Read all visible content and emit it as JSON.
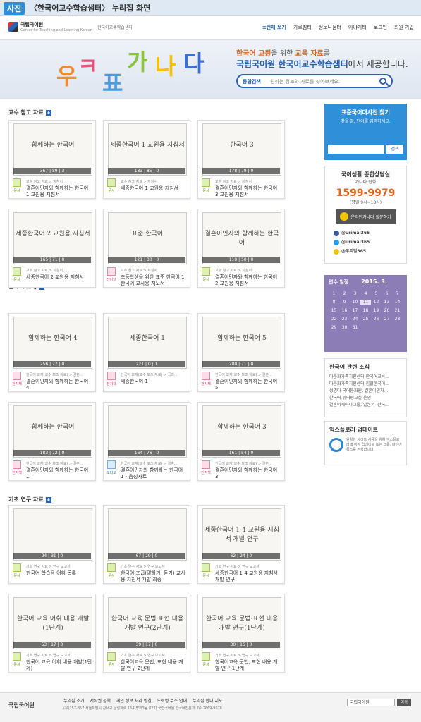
{
  "topbar": {
    "tag": "사진",
    "title": "〈한국어교수학습샘터〉 누리집 화면"
  },
  "header": {
    "org": "국립국어원",
    "org_en": "Center for Teaching and Learning Korean",
    "site": "한국어교수학습샘터",
    "nav": [
      "≡전체 보기",
      "가르침터",
      "정보나눔터",
      "이야기터",
      "로그인",
      "회원 가입"
    ]
  },
  "banner": {
    "line1_pre": "한국어 교원",
    "line1_mid": "을 위한 ",
    "line1_hl": "교육 자료",
    "line1_post": "를",
    "line2_hl": "국립국어원 한국어교수학습샘터",
    "line2_post": "에서 제공합니다.",
    "search_label": "통합검색",
    "search_placeholder": "원하는 정보와 자료를 찾아보세요."
  },
  "sections": [
    {
      "title": "교수 참고 자료",
      "items": [
        {
          "thumb": "함께하는 한국어",
          "stats": "367 | 89 | 3",
          "type": "문서",
          "meta": "교수 참고 자료 > 지침서",
          "name": "결혼이민자와 함께하는 한국어 1 교원용 지침서"
        },
        {
          "thumb": "세종한국어 1 교원용 지침서",
          "stats": "183 | 85 | 0",
          "type": "문서",
          "meta": "교수 참고 자료 > 지침서",
          "name": "세종한국어 1 교원용 지침서"
        },
        {
          "thumb": "한국어 3",
          "stats": "178 | 79 | 0",
          "type": "문서",
          "meta": "교수 참고 자료 > 지침서",
          "name": "결혼이민자와 함께하는 한국어 3 교원용 지침서"
        },
        {
          "thumb": "세종한국어 2 교원용 지침서",
          "stats": "165 | 71 | 0",
          "type": "문서",
          "meta": "교수 참고 자료 > 지침서",
          "name": "세종한국어 2 교원용 지침서"
        },
        {
          "thumb": "표준 한국어",
          "stats": "121 | 30 | 0",
          "type": "전자책",
          "meta": "교수 참고 자료 > 지침서",
          "name": "초등학생을 위한 표준 한국어 1 한국어 교사용 지도서"
        },
        {
          "thumb": "결혼이민자와 함께하는 한국어",
          "stats": "110 | 50 | 0",
          "type": "문서",
          "meta": "교수 참고 자료 > 지침서",
          "name": "결혼이민자와 함께하는 한국어 2 교원용 지침서"
        }
      ]
    },
    {
      "title": "한국어 교재",
      "items": [
        {
          "thumb": "함께하는 한국어 4",
          "stats": "256 | 77 | 0",
          "type": "전자책",
          "meta": "한국어 교재(교수 보조 자료) > 결혼...",
          "name": "결혼이민자와 함께하는 한국어 4"
        },
        {
          "thumb": "세종한국어 1",
          "stats": "221 | 0 | 1",
          "type": "전자책",
          "meta": "한국어 교재(교수 보조 자료) > 국외...",
          "name": "세종한국어 1"
        },
        {
          "thumb": "함께하는 한국어 5",
          "stats": "200 | 71 | 0",
          "type": "전자책",
          "meta": "한국어 교재(교수 보조 자료) > 결혼...",
          "name": "결혼이민자와 함께하는 한국어 5"
        },
        {
          "thumb": "함께하는 한국어",
          "stats": "183 | 72 | 0",
          "type": "전자책",
          "meta": "한국어 교재(교수 보조 자료) > 결혼...",
          "name": "결혼이민자와 함께하는 한국어 1"
        },
        {
          "thumb": "",
          "stats": "164 | 76 | 0",
          "type": "오디오",
          "meta": "한국어 교재(교수 보조 자료) > 결혼...",
          "name": "결혼이민자와 함께하는 한국어 1 - 음성자료"
        },
        {
          "thumb": "함께하는 한국어 3",
          "stats": "161 | 54 | 0",
          "type": "전자책",
          "meta": "한국어 교재(교수 보조 자료) > 결혼...",
          "name": "결혼이민자와 함께하는 한국어 3"
        }
      ]
    },
    {
      "title": "기초 연구 자료",
      "items": [
        {
          "thumb": "",
          "stats": "94 | 31 | 0",
          "type": "문서",
          "meta": "기초 연구 자료 > 연구 보고서",
          "name": "한국어 학습용 어휘 목록"
        },
        {
          "thumb": "",
          "stats": "67 | 29 | 0",
          "type": "문서",
          "meta": "기초 연구 자료 > 연구 보고서",
          "name": "한국어 초급(말하기, 듣기) 교사용 지침서 개발 최종"
        },
        {
          "thumb": "세종한국어 1-4 교원용 지침서 개발 연구",
          "stats": "62 | 24 | 0",
          "type": "문서",
          "meta": "기초 연구 자료 > 연구 보고서",
          "name": "세종한국어 1-4 교원용 지침서 개발 연구"
        },
        {
          "thumb": "한국어 교육 어휘 내용 개발(1단계)",
          "stats": "53 | 17 | 0",
          "type": "문서",
          "meta": "기초 연구 자료 > 연구 보고서",
          "name": "한국어 교육 어휘 내용 개발(1단계)"
        },
        {
          "thumb": "한국어 교육 문법·표현 내용 개발 연구(2단계)",
          "stats": "39 | 17 | 0",
          "type": "문서",
          "meta": "기초 연구 자료 > 연구 보고서",
          "name": "한국어교육 문법, 표현 내용 개발 연구 2단계"
        },
        {
          "thumb": "한국어 교육 문법·표현 내용 개발 연구(1단계)",
          "stats": "30 | 16 | 0",
          "type": "문서",
          "meta": "기초 연구 자료 > 연구 보고서",
          "name": "한국어교육 문법, 표현 내용 개발 연구 1단계"
        }
      ]
    }
  ],
  "side": {
    "quick_title": "표준국어대사전 찾기",
    "quick_sub": "찾을 말, 단어를 입력하세요.",
    "quick_btn": "검색",
    "call_title": "국어생활 종합상담실",
    "call_sub": "가나다 전화",
    "call_num": "1599-9979",
    "call_time": "(평일 9시~18시)",
    "call_ask": "온라인가나다 질문하기",
    "sns": [
      "@urimal365",
      "@urimal365",
      "@우리말365"
    ],
    "cal_title": "연수 일정",
    "cal_month": "2015. 3.",
    "cal_rows": [
      [
        "1",
        "2",
        "3",
        "4",
        "5",
        "6",
        "7"
      ],
      [
        "8",
        "9",
        "10",
        "11",
        "12",
        "13",
        "14"
      ],
      [
        "15",
        "16",
        "17",
        "18",
        "19",
        "20",
        "21"
      ],
      [
        "22",
        "23",
        "24",
        "25",
        "26",
        "27",
        "28"
      ],
      [
        "29",
        "30",
        "31",
        "",
        "",
        "",
        ""
      ]
    ],
    "news_title": "한국어 관련 소식",
    "news": [
      "다문화가족지원센터 한국어교육...",
      "다문화가족지원센터 집합한국어...",
      "성명다 국어문화원, 결혼이민자...",
      "한국어 튜터링교실 운영",
      "결혼이세아나그룹, 일본서 '한국..."
    ],
    "ie_title": "익스플로러 업데이트",
    "ie_text": "원활한 사이트 사용을 위해 익스플로러 8 이상 업데이트 또는 크롬, 파이어폭스를 권장합니다."
  },
  "footer": {
    "logo": "국립국어원",
    "links": [
      "누리집 소개",
      "저작권 정책",
      "개인 정보 처리 방침",
      "도로명 주소 안내",
      "누리집 안내 지도"
    ],
    "addr": "(우)157-857 서울특별시 강서구 금낭화로 154(방화3동 827)   국립국어원 한국어진흥과: 02-2669-9676",
    "select": "국립국어원",
    "go": "이동"
  }
}
